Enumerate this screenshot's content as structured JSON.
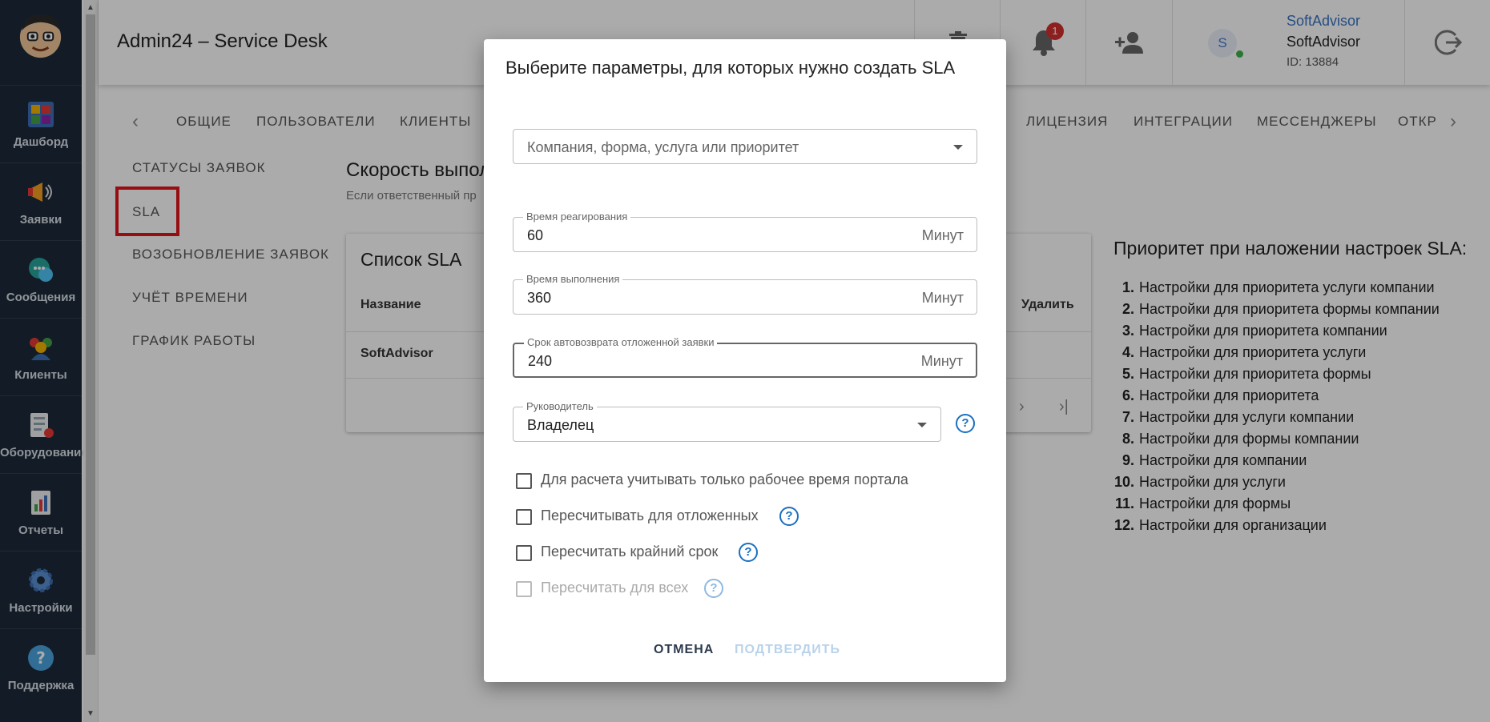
{
  "app": {
    "title": "Admin24 – Service Desk",
    "notifications_count": "1",
    "user_initial": "S",
    "user_link": "SoftAdvisor",
    "user_name": "SoftAdvisor",
    "user_id": "ID: 13884"
  },
  "sidebar": {
    "items": [
      {
        "label": "Дашборд",
        "icon": "dashboard-icon"
      },
      {
        "label": "Заявки",
        "icon": "megaphone-icon"
      },
      {
        "label": "Сообщения",
        "icon": "chat-icon"
      },
      {
        "label": "Клиенты",
        "icon": "clients-icon"
      },
      {
        "label": "Оборудование",
        "icon": "equipment-icon"
      },
      {
        "label": "Отчеты",
        "icon": "reports-icon"
      },
      {
        "label": "Настройки",
        "icon": "gear-icon"
      },
      {
        "label": "Поддержка",
        "icon": "support-icon"
      }
    ]
  },
  "tabs": [
    "Общие",
    "Пользователи",
    "Клиенты",
    "Лицензия",
    "Интеграции",
    "Мессенджеры",
    "Откр"
  ],
  "submenu": [
    "Статусы заявок",
    "SLA",
    "Возобновление заявок",
    "Учёт времени",
    "График работы"
  ],
  "main": {
    "title": "Скорость выпол",
    "subtitle": "Если ответственный пр",
    "card_title": "Список SLA",
    "col_name": "Название",
    "col_delete": "Удалить",
    "row_name": "SoftAdvisor"
  },
  "priority": {
    "title": "Приоритет при наложении настроек SLA:",
    "items": [
      "Настройки для приоритета услуги компании",
      "Настройки для приоритета формы компании",
      "Настройки для приоритета компании",
      "Настройки для приоритета услуги",
      "Настройки для приоритета формы",
      "Настройки для приоритета",
      "Настройки для услуги компании",
      "Настройки для формы компании",
      "Настройки для компании",
      "Настройки для услуги",
      "Настройки для формы",
      "Настройки для организации"
    ]
  },
  "dialog": {
    "title": "Выберите параметры, для которых нужно создать SLA",
    "selector_placeholder": "Компания, форма, услуга или приоритет",
    "reaction_label": "Время реагирования",
    "reaction_value": "60",
    "execution_label": "Время выполнения",
    "execution_value": "360",
    "autoreturn_label": "Срок автовозврата отложенной заявки",
    "autoreturn_value": "240",
    "unit": "Минут",
    "manager_label": "Руководитель",
    "manager_value": "Владелец",
    "checkboxes": [
      {
        "label": "Для расчета учитывать только рабочее время портала",
        "checked": false,
        "disabled": false
      },
      {
        "label": "Пересчитывать для отложенных",
        "checked": false,
        "disabled": false
      },
      {
        "label": "Пересчитать крайний срок",
        "checked": false,
        "disabled": false
      },
      {
        "label": "Пересчитать для всех",
        "checked": false,
        "disabled": true
      }
    ],
    "cancel": "Отмена",
    "confirm": "Подтвердить"
  },
  "colors": {
    "sidebar_bg": "#1d2a3a",
    "accent_blue": "#1a6fc0",
    "highlight_red": "#e0151b",
    "badge_red": "#d32f2f"
  }
}
